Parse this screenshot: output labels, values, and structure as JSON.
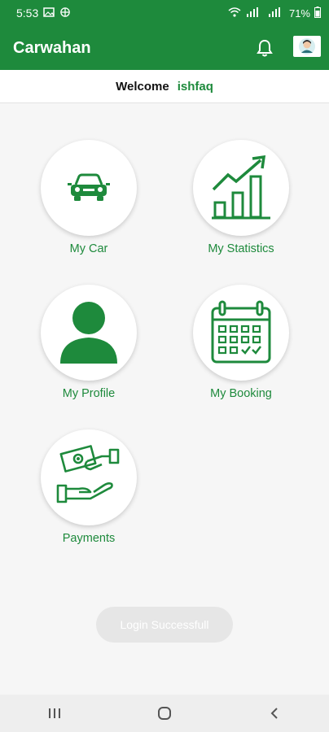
{
  "status": {
    "time": "5:53",
    "battery": "71%"
  },
  "app": {
    "title": "Carwahan"
  },
  "welcome": {
    "label": "Welcome",
    "username": "ishfaq"
  },
  "tiles": [
    {
      "label": "My Car",
      "icon": "car-icon"
    },
    {
      "label": "My Statistics",
      "icon": "statistics-icon"
    },
    {
      "label": "My Profile",
      "icon": "profile-icon"
    },
    {
      "label": "My Booking",
      "icon": "calendar-icon"
    },
    {
      "label": "Payments",
      "icon": "payment-icon"
    }
  ],
  "toast": {
    "text": "Login Successfull"
  },
  "colors": {
    "primary": "#1e8a3c",
    "background": "#f6f6f6"
  }
}
